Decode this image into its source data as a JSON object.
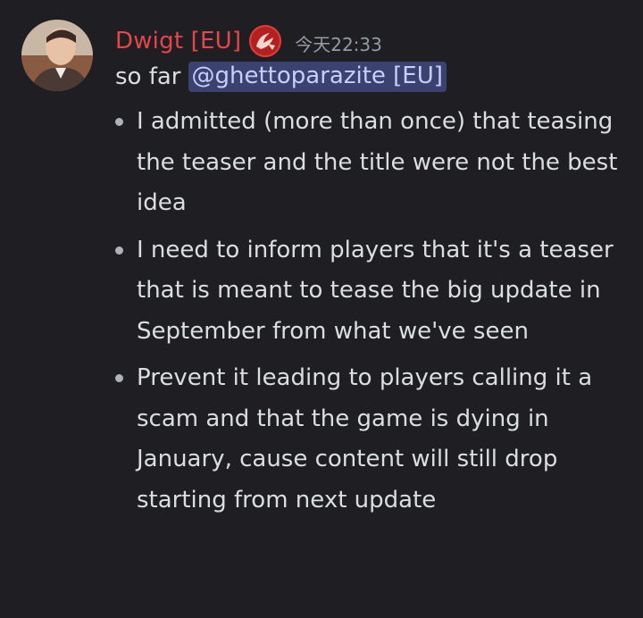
{
  "message": {
    "author": "Dwigt [EU]",
    "author_color": "#e5464a",
    "role_icon": "world-of-tanks-icon",
    "timestamp": "今天22:33",
    "intro_text": "so far",
    "mention": "@ghettoparazite [EU]",
    "bullets": [
      "I admitted (more than once) that teasing the teaser and the title were not the best idea",
      "I need to inform players that it's a teaser that is meant to tease the big update in September from what we've seen",
      "Prevent it leading to players calling it a scam and that the game is dying in January, cause content will still drop starting from next update"
    ]
  }
}
